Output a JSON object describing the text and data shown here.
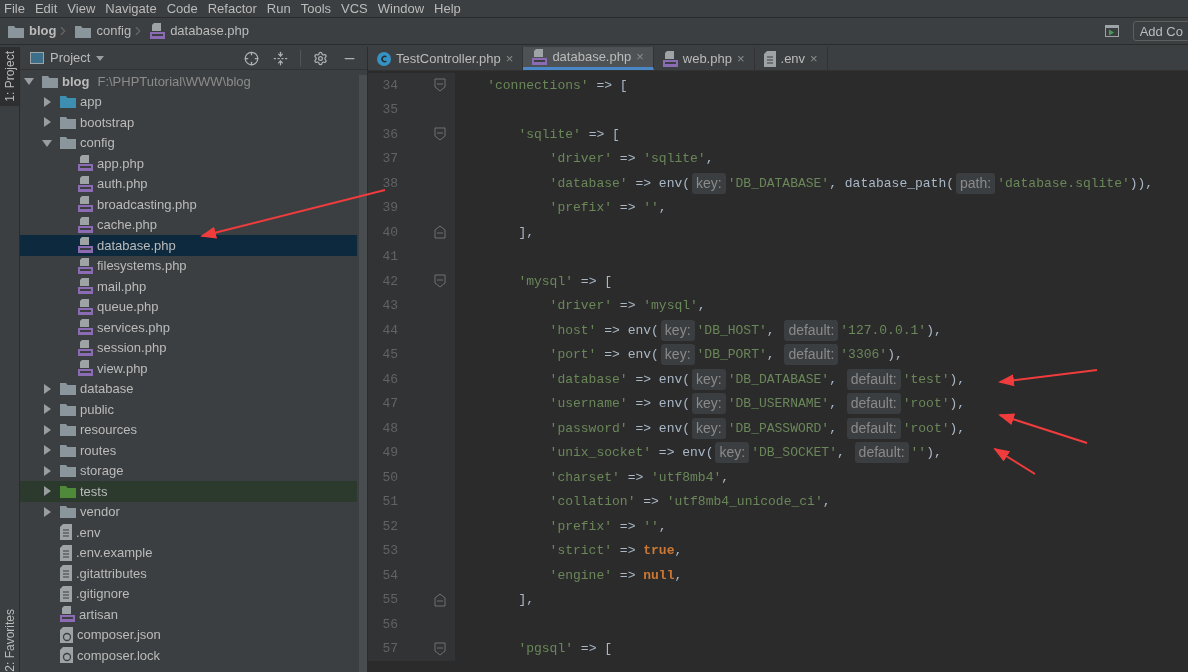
{
  "menu": [
    "File",
    "Edit",
    "View",
    "Navigate",
    "Code",
    "Refactor",
    "Run",
    "Tools",
    "VCS",
    "Window",
    "Help"
  ],
  "breadcrumb": [
    {
      "label": "blog",
      "kind": "folder"
    },
    {
      "label": "config",
      "kind": "folder"
    },
    {
      "label": "database.php",
      "kind": "php"
    }
  ],
  "toolbar": {
    "add_configuration": "Add Co"
  },
  "side_stripe": {
    "top": "1: Project",
    "bottom": "2: Favorites"
  },
  "project_panel": {
    "title": "Project",
    "tree": [
      {
        "name": "blog",
        "path": "F:\\PHPTutorial\\WWW\\blog",
        "kind": "folder",
        "expanded": true,
        "selected": false,
        "children": [
          {
            "name": "app",
            "kind": "source-folder",
            "expanded": false,
            "selected": false
          },
          {
            "name": "bootstrap",
            "kind": "folder",
            "expanded": false,
            "selected": false
          },
          {
            "name": "config",
            "kind": "folder",
            "expanded": true,
            "selected": false,
            "children": [
              {
                "name": "app.php",
                "kind": "php",
                "selected": false
              },
              {
                "name": "auth.php",
                "kind": "php",
                "selected": false
              },
              {
                "name": "broadcasting.php",
                "kind": "php",
                "selected": false
              },
              {
                "name": "cache.php",
                "kind": "php",
                "selected": false
              },
              {
                "name": "database.php",
                "kind": "php",
                "selected": true
              },
              {
                "name": "filesystems.php",
                "kind": "php",
                "selected": false
              },
              {
                "name": "mail.php",
                "kind": "php",
                "selected": false
              },
              {
                "name": "queue.php",
                "kind": "php",
                "selected": false
              },
              {
                "name": "services.php",
                "kind": "php",
                "selected": false
              },
              {
                "name": "session.php",
                "kind": "php",
                "selected": false
              },
              {
                "name": "view.php",
                "kind": "php",
                "selected": false
              }
            ]
          },
          {
            "name": "database",
            "kind": "folder",
            "expanded": false,
            "selected": false
          },
          {
            "name": "public",
            "kind": "folder",
            "expanded": false,
            "selected": false
          },
          {
            "name": "resources",
            "kind": "folder",
            "expanded": false,
            "selected": false
          },
          {
            "name": "routes",
            "kind": "folder",
            "expanded": false,
            "selected": false
          },
          {
            "name": "storage",
            "kind": "folder",
            "expanded": false,
            "selected": false
          },
          {
            "name": "tests",
            "kind": "test-folder",
            "expanded": false,
            "selected": false
          },
          {
            "name": "vendor",
            "kind": "folder",
            "expanded": false,
            "selected": false
          },
          {
            "name": ".env",
            "kind": "text",
            "selected": false
          },
          {
            "name": ".env.example",
            "kind": "text",
            "selected": false
          },
          {
            "name": ".gitattributes",
            "kind": "text",
            "selected": false
          },
          {
            "name": ".gitignore",
            "kind": "text",
            "selected": false
          },
          {
            "name": "artisan",
            "kind": "php",
            "selected": false
          },
          {
            "name": "composer.json",
            "kind": "composer",
            "selected": false
          },
          {
            "name": "composer.lock",
            "kind": "composer",
            "selected": false
          }
        ]
      }
    ]
  },
  "editor_tabs": [
    {
      "label": "TestController.php",
      "kind": "class",
      "selected": false,
      "close": "×"
    },
    {
      "label": "database.php",
      "kind": "php",
      "selected": true,
      "close": "×"
    },
    {
      "label": "web.php",
      "kind": "php",
      "selected": false,
      "close": "×"
    },
    {
      "label": ".env",
      "kind": "text",
      "selected": false,
      "close": "×"
    }
  ],
  "code_lines": [
    {
      "number": "34",
      "kind": "fold-start",
      "tokens": [
        {
          "kind": "string",
          "text": "    'connections'"
        },
        {
          "kind": "plain",
          "text": " => ["
        }
      ]
    },
    {
      "number": "35"
    },
    {
      "number": "36",
      "kind": "fold-start",
      "tokens": [
        {
          "kind": "string",
          "text": "        'sqlite'"
        },
        {
          "kind": "plain",
          "text": " => ["
        }
      ]
    },
    {
      "number": "37",
      "tokens": [
        {
          "kind": "string",
          "text": "            'driver'"
        },
        {
          "kind": "plain",
          "text": " => "
        },
        {
          "kind": "string",
          "text": "'sqlite'"
        },
        {
          "kind": "plain",
          "text": ","
        }
      ]
    },
    {
      "number": "38",
      "tokens": [
        {
          "kind": "string",
          "text": "            'database'"
        },
        {
          "kind": "plain",
          "text": " => env("
        },
        {
          "kind": "hint",
          "text": "key:"
        },
        {
          "kind": "string",
          "text": "'DB_DATABASE'"
        },
        {
          "kind": "plain",
          "text": ", database_path("
        },
        {
          "kind": "hint",
          "text": "path:"
        },
        {
          "kind": "string",
          "text": "'database.sqlite'"
        },
        {
          "kind": "plain",
          "text": ")),"
        }
      ]
    },
    {
      "number": "39",
      "tokens": [
        {
          "kind": "string",
          "text": "            'prefix'"
        },
        {
          "kind": "plain",
          "text": " => "
        },
        {
          "kind": "string",
          "text": "''"
        },
        {
          "kind": "plain",
          "text": ","
        }
      ]
    },
    {
      "number": "40",
      "kind": "fold-end",
      "tokens": [
        {
          "kind": "plain",
          "text": "        ],"
        }
      ]
    },
    {
      "number": "41"
    },
    {
      "number": "42",
      "kind": "fold-start",
      "tokens": [
        {
          "kind": "string",
          "text": "        'mysql'"
        },
        {
          "kind": "plain",
          "text": " => ["
        }
      ]
    },
    {
      "number": "43",
      "tokens": [
        {
          "kind": "string",
          "text": "            'driver'"
        },
        {
          "kind": "plain",
          "text": " => "
        },
        {
          "kind": "string",
          "text": "'mysql'"
        },
        {
          "kind": "plain",
          "text": ","
        }
      ]
    },
    {
      "number": "44",
      "tokens": [
        {
          "kind": "string",
          "text": "            'host'"
        },
        {
          "kind": "plain",
          "text": " => env("
        },
        {
          "kind": "hint",
          "text": "key:"
        },
        {
          "kind": "string",
          "text": "'DB_HOST'"
        },
        {
          "kind": "plain",
          "text": ", "
        },
        {
          "kind": "hint",
          "text": "default:"
        },
        {
          "kind": "string",
          "text": "'127.0.0.1'"
        },
        {
          "kind": "plain",
          "text": "),"
        }
      ]
    },
    {
      "number": "45",
      "tokens": [
        {
          "kind": "string",
          "text": "            'port'"
        },
        {
          "kind": "plain",
          "text": " => env("
        },
        {
          "kind": "hint",
          "text": "key:"
        },
        {
          "kind": "string",
          "text": "'DB_PORT'"
        },
        {
          "kind": "plain",
          "text": ", "
        },
        {
          "kind": "hint",
          "text": "default:"
        },
        {
          "kind": "string",
          "text": "'3306'"
        },
        {
          "kind": "plain",
          "text": "),"
        }
      ]
    },
    {
      "number": "46",
      "tokens": [
        {
          "kind": "string",
          "text": "            'database'"
        },
        {
          "kind": "plain",
          "text": " => env("
        },
        {
          "kind": "hint",
          "text": "key:"
        },
        {
          "kind": "string",
          "text": "'DB_DATABASE'"
        },
        {
          "kind": "plain",
          "text": ", "
        },
        {
          "kind": "hint",
          "text": "default:"
        },
        {
          "kind": "string",
          "text": "'test'"
        },
        {
          "kind": "plain",
          "text": "),"
        }
      ]
    },
    {
      "number": "47",
      "tokens": [
        {
          "kind": "string",
          "text": "            'username'"
        },
        {
          "kind": "plain",
          "text": " => env("
        },
        {
          "kind": "hint",
          "text": "key:"
        },
        {
          "kind": "string",
          "text": "'DB_USERNAME'"
        },
        {
          "kind": "plain",
          "text": ", "
        },
        {
          "kind": "hint",
          "text": "default:"
        },
        {
          "kind": "string",
          "text": "'root'"
        },
        {
          "kind": "plain",
          "text": "),"
        }
      ]
    },
    {
      "number": "48",
      "tokens": [
        {
          "kind": "string",
          "text": "            'password'"
        },
        {
          "kind": "plain",
          "text": " => env("
        },
        {
          "kind": "hint",
          "text": "key:"
        },
        {
          "kind": "string",
          "text": "'DB_PASSWORD'"
        },
        {
          "kind": "plain",
          "text": ", "
        },
        {
          "kind": "hint",
          "text": "default:"
        },
        {
          "kind": "string",
          "text": "'root'"
        },
        {
          "kind": "plain",
          "text": "),"
        }
      ]
    },
    {
      "number": "49",
      "tokens": [
        {
          "kind": "string",
          "text": "            'unix_socket'"
        },
        {
          "kind": "plain",
          "text": " => env("
        },
        {
          "kind": "hint",
          "text": "key:"
        },
        {
          "kind": "string",
          "text": "'DB_SOCKET'"
        },
        {
          "kind": "plain",
          "text": ", "
        },
        {
          "kind": "hint",
          "text": "default:"
        },
        {
          "kind": "string",
          "text": "''"
        },
        {
          "kind": "plain",
          "text": "),"
        }
      ]
    },
    {
      "number": "50",
      "tokens": [
        {
          "kind": "string",
          "text": "            'charset'"
        },
        {
          "kind": "plain",
          "text": " => "
        },
        {
          "kind": "string",
          "text": "'utf8mb4'"
        },
        {
          "kind": "plain",
          "text": ","
        }
      ]
    },
    {
      "number": "51",
      "tokens": [
        {
          "kind": "string",
          "text": "            'collation'"
        },
        {
          "kind": "plain",
          "text": " => "
        },
        {
          "kind": "string",
          "text": "'utf8mb4_unicode_ci'"
        },
        {
          "kind": "plain",
          "text": ","
        }
      ]
    },
    {
      "number": "52",
      "tokens": [
        {
          "kind": "string",
          "text": "            'prefix'"
        },
        {
          "kind": "plain",
          "text": " => "
        },
        {
          "kind": "string",
          "text": "''"
        },
        {
          "kind": "plain",
          "text": ","
        }
      ]
    },
    {
      "number": "53",
      "tokens": [
        {
          "kind": "string",
          "text": "            'strict'"
        },
        {
          "kind": "plain",
          "text": " => "
        },
        {
          "kind": "keyword",
          "text": "true"
        },
        {
          "kind": "plain",
          "text": ","
        }
      ]
    },
    {
      "number": "54",
      "tokens": [
        {
          "kind": "string",
          "text": "            'engine'"
        },
        {
          "kind": "plain",
          "text": " => "
        },
        {
          "kind": "keyword",
          "text": "null"
        },
        {
          "kind": "plain",
          "text": ","
        }
      ]
    },
    {
      "number": "55",
      "kind": "fold-end",
      "tokens": [
        {
          "kind": "plain",
          "text": "        ],"
        }
      ]
    },
    {
      "number": "56"
    },
    {
      "number": "57",
      "kind": "fold-start",
      "tokens": [
        {
          "kind": "string",
          "text": "        'pgsql'"
        },
        {
          "kind": "plain",
          "text": " => ["
        }
      ]
    }
  ]
}
